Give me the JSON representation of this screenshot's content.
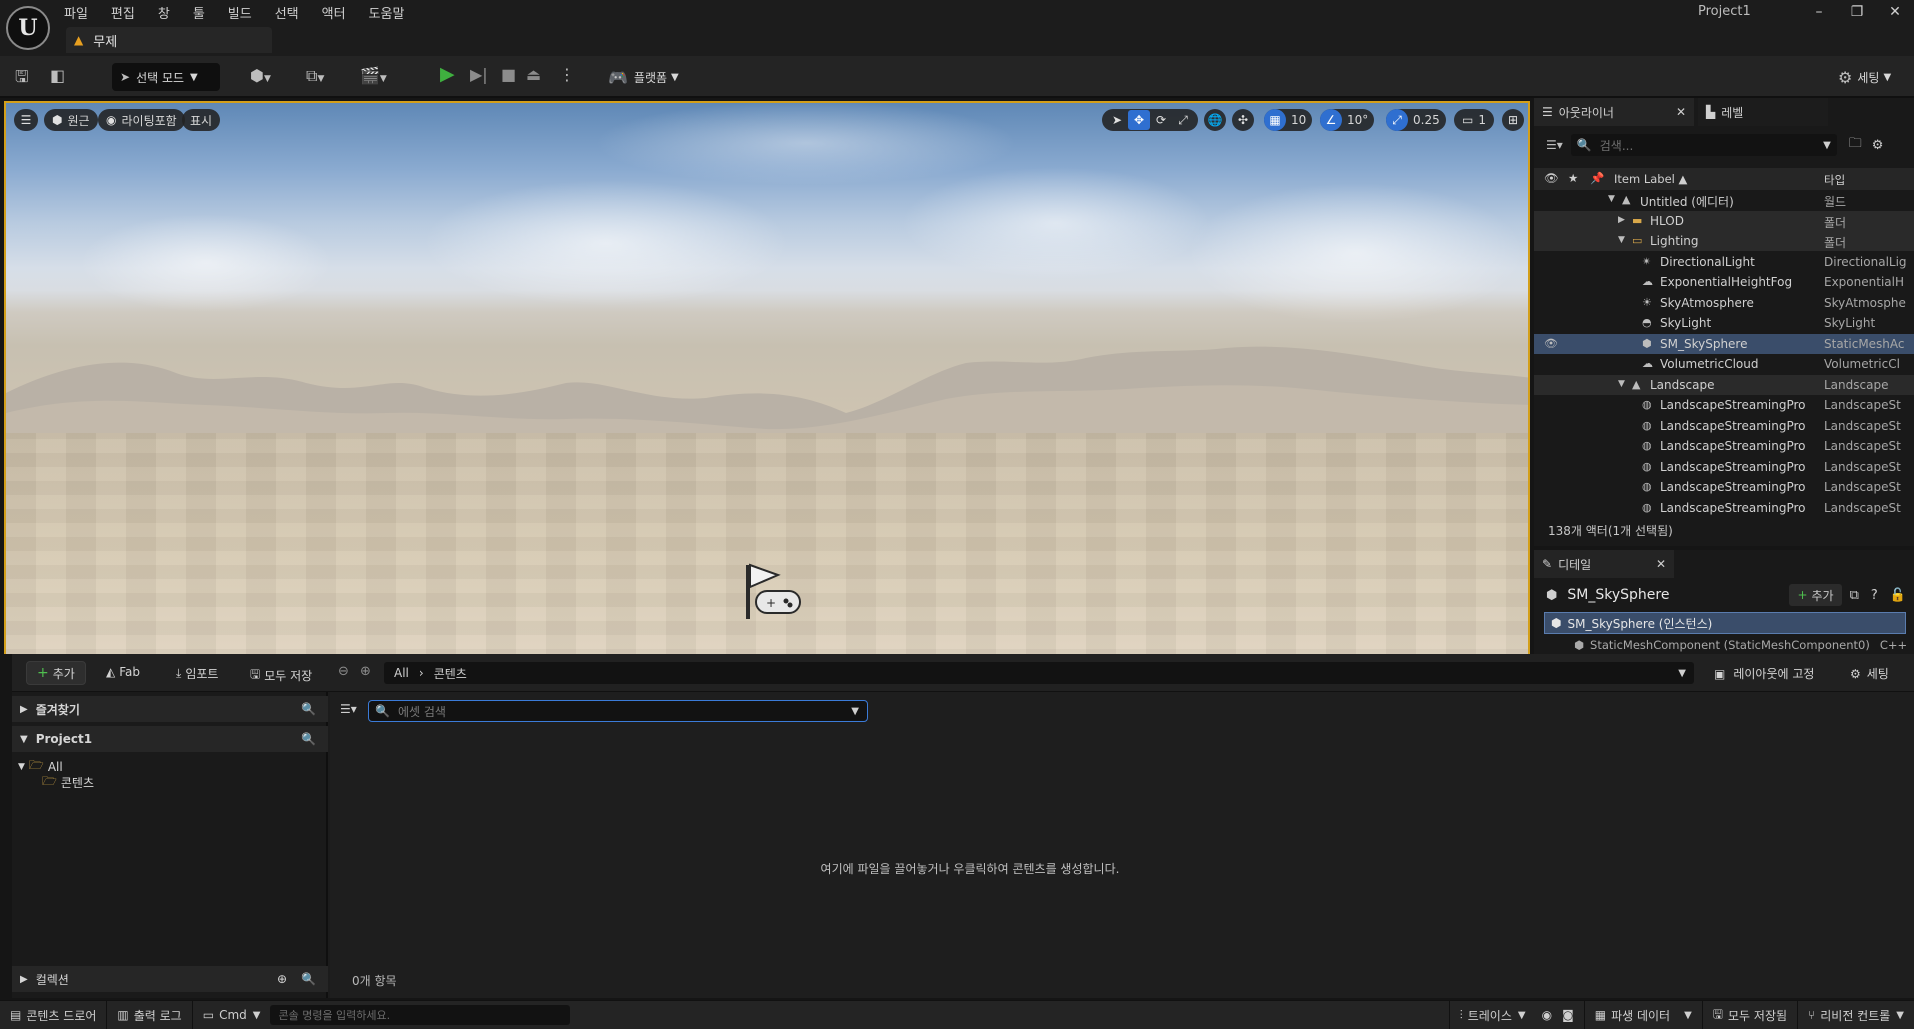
{
  "window": {
    "project_name": "Project1",
    "doc_tab": "무제",
    "controls": {
      "minimize": "–",
      "maximize": "❐",
      "close": "✕"
    }
  },
  "menu": [
    "파일",
    "편집",
    "창",
    "툴",
    "빌드",
    "선택",
    "액터",
    "도움말"
  ],
  "toolbar": {
    "mode_label": "선택 모드",
    "platform_label": "플랫폼",
    "settings_label": "세팅"
  },
  "viewport": {
    "perspective_label": "원근",
    "lighting_label": "라이팅포함",
    "show_label": "표시",
    "grid_snap": "10",
    "rotation_snap": "10°",
    "scale_snap": "0.25",
    "camera_speed": "1"
  },
  "outliner": {
    "tab_label": "아웃라이너",
    "levels_tab_label": "레벨",
    "search_placeholder": "검색...",
    "col_label": "Item Label ▲",
    "col_type": "타입",
    "rows": [
      {
        "name": "Untitled (에디터)",
        "type": "월드",
        "indent": 0,
        "icon": "level-icon",
        "expand": "▼"
      },
      {
        "name": "HLOD",
        "type": "폴더",
        "indent": 1,
        "icon": "folder-icon",
        "expand": "▶"
      },
      {
        "name": "Lighting",
        "type": "폴더",
        "indent": 1,
        "icon": "folder-open-icon",
        "expand": "▼"
      },
      {
        "name": "DirectionalLight",
        "type": "DirectionalLig",
        "indent": 2,
        "icon": "directional-light-icon"
      },
      {
        "name": "ExponentialHeightFog",
        "type": "ExponentialH",
        "indent": 2,
        "icon": "fog-icon"
      },
      {
        "name": "SkyAtmosphere",
        "type": "SkyAtmosphe",
        "indent": 2,
        "icon": "sky-atmosphere-icon"
      },
      {
        "name": "SkyLight",
        "type": "SkyLight",
        "indent": 2,
        "icon": "sky-light-icon"
      },
      {
        "name": "SM_SkySphere",
        "type": "StaticMeshAc",
        "indent": 2,
        "icon": "static-mesh-icon",
        "selected": true
      },
      {
        "name": "VolumetricCloud",
        "type": "VolumetricCl",
        "indent": 2,
        "icon": "cloud-icon"
      },
      {
        "name": "Landscape",
        "type": "Landscape",
        "indent": 1,
        "icon": "landscape-icon",
        "expand": "▼"
      },
      {
        "name": "LandscapeStreamingPro",
        "type": "LandscapeSt",
        "indent": 2,
        "icon": "landscape-proxy-icon"
      },
      {
        "name": "LandscapeStreamingPro",
        "type": "LandscapeSt",
        "indent": 2,
        "icon": "landscape-proxy-icon"
      },
      {
        "name": "LandscapeStreamingPro",
        "type": "LandscapeSt",
        "indent": 2,
        "icon": "landscape-proxy-icon"
      },
      {
        "name": "LandscapeStreamingPro",
        "type": "LandscapeSt",
        "indent": 2,
        "icon": "landscape-proxy-icon"
      },
      {
        "name": "LandscapeStreamingPro",
        "type": "LandscapeSt",
        "indent": 2,
        "icon": "landscape-proxy-icon"
      },
      {
        "name": "LandscapeStreamingPro",
        "type": "LandscapeSt",
        "indent": 2,
        "icon": "landscape-proxy-icon"
      }
    ],
    "count_text": "138개 액터(1개 선택됨)"
  },
  "details": {
    "tab_label": "디테일",
    "actor_name": "SM_SkySphere",
    "add_label": "추가",
    "instance_label": "SM_SkySphere (인스턴스)",
    "component_label": "StaticMeshComponent (StaticMeshComponent0)",
    "component_suffix": "C++"
  },
  "content_browser": {
    "add_label": "추가",
    "fab_label": "Fab",
    "import_label": "임포트",
    "save_all_label": "모두 저장",
    "path_root": "All",
    "path_leaf": "콘텐츠",
    "lock_layout_label": "레이아웃에 고정",
    "settings_label": "세팅",
    "favorites_label": "즐겨찾기",
    "project_label": "Project1",
    "tree_all": "All",
    "tree_content": "콘텐츠",
    "collections_label": "컬렉션",
    "search_placeholder": "에셋 검색",
    "empty_message": "여기에 파일을 끌어놓거나 우클릭하여 콘텐츠를 생성합니다.",
    "item_count": "0개 항목"
  },
  "statusbar": {
    "content_drawer": "콘텐츠 드로어",
    "output_log": "출력 로그",
    "cmd_label": "Cmd",
    "console_placeholder": "콘솔 명령을 입력하세요.",
    "trace_label": "트레이스",
    "derived_data_label": "파생 데이터",
    "save_all_label": "모두 저장됨",
    "revision_label": "리비전 컨트롤"
  },
  "colors": {
    "accent": "#2f6fd0",
    "viewport_border": "#d39f1a",
    "selection": "#3a4d6a",
    "play": "#3fb03f"
  }
}
